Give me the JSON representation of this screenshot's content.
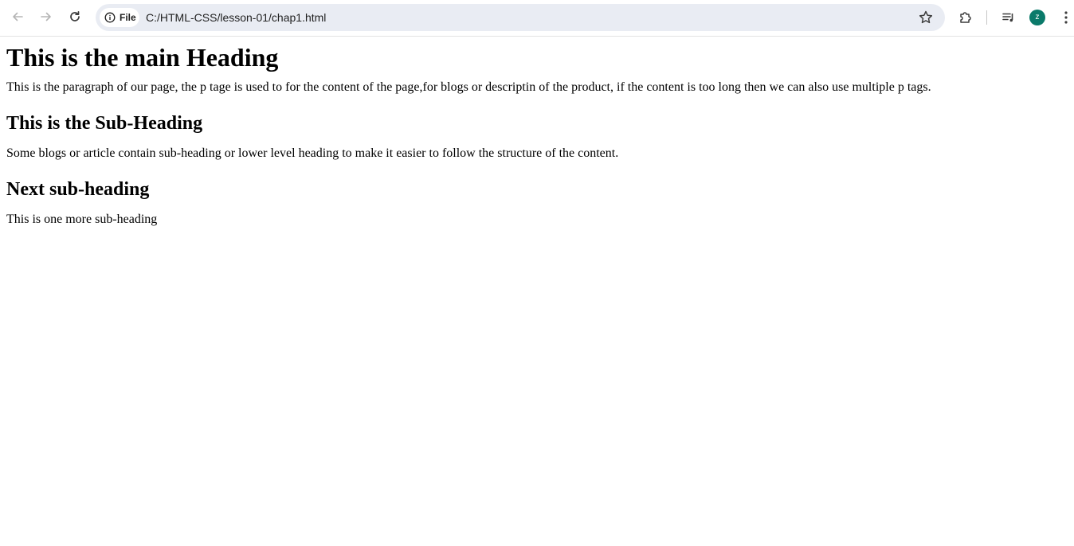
{
  "browser": {
    "security_chip_label": "File",
    "url": "C:/HTML-CSS/lesson-01/chap1.html",
    "profile_initial": "z",
    "icons": {
      "back": "arrow-left-icon",
      "forward": "arrow-right-icon",
      "reload": "reload-icon",
      "info": "info-icon",
      "bookmark": "star-icon",
      "extensions": "puzzle-icon",
      "media": "media-queue-icon",
      "menu": "kebab-menu-icon"
    },
    "colors": {
      "omnibox_bg": "#e9ecf3",
      "avatar_bg": "#0b7a6a"
    }
  },
  "page": {
    "main_heading": "This is the main Heading",
    "paragraph_1": "This is the paragraph of our page, the p tage is used to for the content of the page,for blogs or descriptin of the product, if the content is too long then we can also use multiple p tags.",
    "sub_heading_1": "This is the Sub-Heading",
    "paragraph_2": "Some blogs or article contain sub-heading or lower level heading to make it easier to follow the structure of the content.",
    "sub_heading_2": "Next sub-heading",
    "paragraph_3": "This is one more sub-heading"
  }
}
